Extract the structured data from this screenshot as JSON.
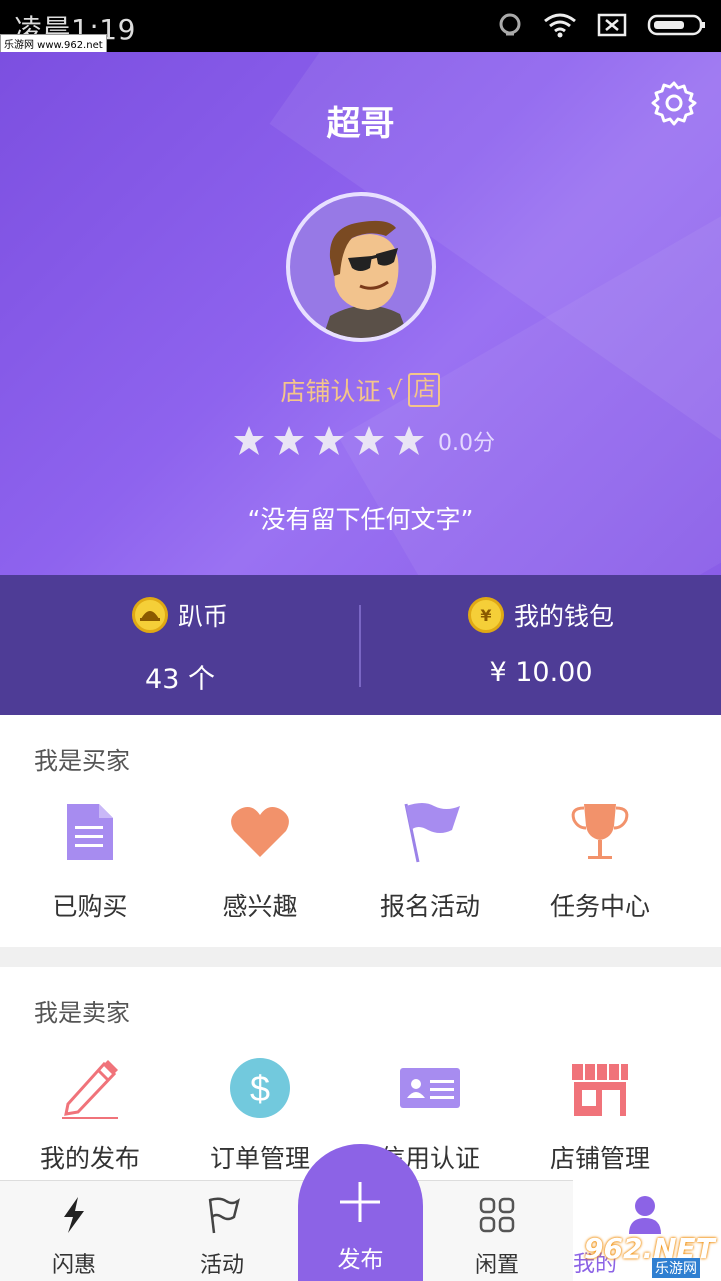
{
  "status_bar": {
    "time": "凌晨1:19",
    "watermark": "乐游网 www.962.net"
  },
  "header": {
    "title": "超哥",
    "certification": "店铺认证",
    "cert_mark": "√",
    "store_badge": "店",
    "rating_stars": 5,
    "score": "0.0分",
    "motto": "“没有留下任何文字”"
  },
  "stats": {
    "coins": {
      "label": "趴币",
      "value": "43  个"
    },
    "wallet": {
      "label": "我的钱包",
      "value": "¥  10.00",
      "icon": "¥"
    }
  },
  "buyer": {
    "title": "我是买家",
    "items": [
      {
        "label": "已购买",
        "icon": "document-icon"
      },
      {
        "label": "感兴趣",
        "icon": "heart-icon"
      },
      {
        "label": "报名活动",
        "icon": "flag-icon"
      },
      {
        "label": "任务中心",
        "icon": "trophy-icon"
      }
    ]
  },
  "seller": {
    "title": "我是卖家",
    "items": [
      {
        "label": "我的发布",
        "icon": "pencil-icon"
      },
      {
        "label": "订单管理",
        "icon": "dollar-icon"
      },
      {
        "label": "信用认证",
        "icon": "id-card-icon"
      },
      {
        "label": "店铺管理",
        "icon": "store-icon"
      }
    ]
  },
  "nav": {
    "items": [
      {
        "label": "闪惠",
        "icon": "lightning-icon"
      },
      {
        "label": "活动",
        "icon": "flag-outline-icon"
      },
      {
        "label": "发布",
        "icon": "plus-icon"
      },
      {
        "label": "闲置",
        "icon": "grid-icon"
      },
      {
        "label": "我的",
        "icon": "profile-icon"
      }
    ]
  },
  "brand": {
    "mark": "962.NET",
    "sub": "乐游网"
  },
  "colors": {
    "accent": "#8c63e6",
    "header_bg": "#8a5de8",
    "stats_bg": "#4e3c96",
    "gold": "#f4c58a"
  }
}
